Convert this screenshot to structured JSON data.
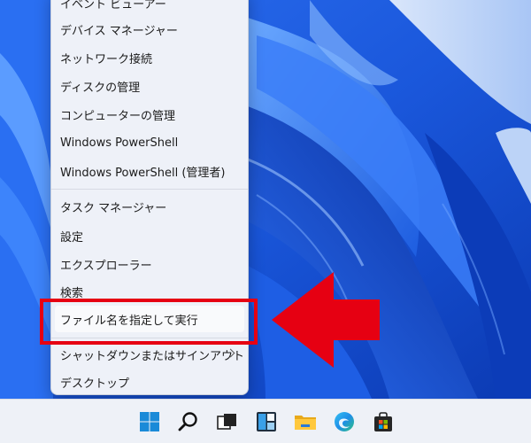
{
  "context_menu": {
    "items": [
      {
        "label": "イベント ビューアー"
      },
      {
        "label": "デバイス マネージャー"
      },
      {
        "label": "ネットワーク接続"
      },
      {
        "label": "ディスクの管理"
      },
      {
        "label": "コンピューターの管理"
      },
      {
        "label": "Windows PowerShell"
      },
      {
        "label": "Windows PowerShell (管理者)"
      },
      {
        "label": "タスク マネージャー"
      },
      {
        "label": "設定"
      },
      {
        "label": "エクスプローラー"
      },
      {
        "label": "検索"
      },
      {
        "label": "ファイル名を指定して実行"
      },
      {
        "label": "シャットダウンまたはサインアウト",
        "has_submenu": true
      },
      {
        "label": "デスクトップ"
      }
    ]
  },
  "annotation": {
    "color": "#e60012",
    "highlighted_item": "ファイル名を指定して実行"
  },
  "taskbar": {
    "icons": [
      "start-icon",
      "search-icon",
      "task-view-icon",
      "widgets-icon",
      "file-explorer-icon",
      "edge-icon",
      "store-icon"
    ]
  },
  "colors": {
    "wallpaper": "#1b5fe0",
    "menu_bg": "#eef1f8",
    "taskbar_bg": "#eef1f7"
  }
}
